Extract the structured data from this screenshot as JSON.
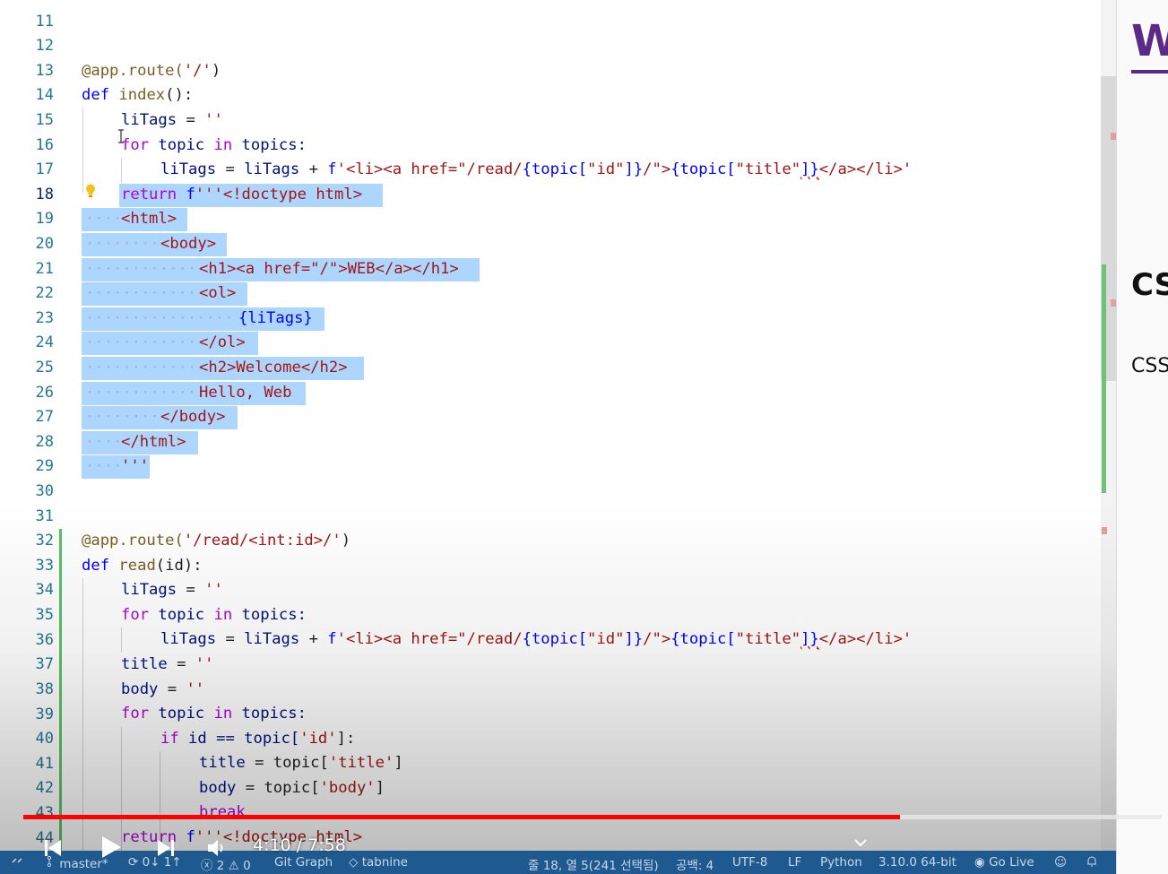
{
  "editor": {
    "lines": [
      {
        "n": "11"
      },
      {
        "n": "12"
      },
      {
        "n": "13"
      },
      {
        "n": "14"
      },
      {
        "n": "15"
      },
      {
        "n": "16"
      },
      {
        "n": "17"
      },
      {
        "n": "18"
      },
      {
        "n": "19"
      },
      {
        "n": "20"
      },
      {
        "n": "21"
      },
      {
        "n": "22"
      },
      {
        "n": "23"
      },
      {
        "n": "24"
      },
      {
        "n": "25"
      },
      {
        "n": "26"
      },
      {
        "n": "27"
      },
      {
        "n": "28"
      },
      {
        "n": "29"
      },
      {
        "n": "30"
      },
      {
        "n": "31"
      },
      {
        "n": "32"
      },
      {
        "n": "33"
      },
      {
        "n": "34"
      },
      {
        "n": "35"
      },
      {
        "n": "36"
      },
      {
        "n": "37"
      },
      {
        "n": "38"
      },
      {
        "n": "39"
      },
      {
        "n": "40"
      },
      {
        "n": "41"
      },
      {
        "n": "42"
      },
      {
        "n": "43"
      },
      {
        "n": "44"
      }
    ],
    "code": {
      "l13": [
        "@app.route(",
        "'/'",
        ")"
      ],
      "l14": [
        "def",
        " index",
        "():"
      ],
      "l15": [
        "liTags",
        " = ",
        "''"
      ],
      "l16": [
        "for",
        " topic ",
        "in",
        " topics:"
      ],
      "l17": [
        "liTags",
        " = ",
        "liTags",
        " + ",
        "f",
        "'<li><a href=\"/read/",
        "{topic[",
        "\"id\"",
        "]}",
        "/\">",
        "{topic[",
        "\"title\"",
        "]}",
        "</a></li>'"
      ],
      "l18": [
        "return",
        " f",
        "'''<!doctype html>"
      ],
      "l19": "<html>",
      "l20": "<body>",
      "l21": "<h1><a href=\"/\">WEB</a></h1>",
      "l22": "<ol>",
      "l23": "{liTags}",
      "l24": "</ol>",
      "l25": "<h2>Welcome</h2>",
      "l26": "Hello, Web",
      "l27": "</body>",
      "l28": "</html>",
      "l29": "'''",
      "l32": [
        "@app.route(",
        "'/read/<int:id>/'",
        ")"
      ],
      "l33": [
        "def",
        " read",
        "(id):"
      ],
      "l34": [
        "liTags",
        " = ",
        "''"
      ],
      "l35": [
        "for",
        " topic ",
        "in",
        " topics:"
      ],
      "l36": [
        "liTags",
        " = ",
        "liTags",
        " + ",
        "f",
        "'<li><a href=\"/read/",
        "{topic[",
        "\"id\"",
        "]}",
        "/\">",
        "{topic[",
        "\"title\"",
        "]}",
        "</a></li>'"
      ],
      "l37": [
        "title",
        " = ",
        "''"
      ],
      "l38": [
        "body",
        " = ",
        "''"
      ],
      "l39": [
        "for",
        " topic ",
        "in",
        " topics:"
      ],
      "l40": [
        "if",
        " id == topic[",
        "'id'",
        "]:"
      ],
      "l41": [
        "title",
        " = topic[",
        "'title'",
        "]"
      ],
      "l42": [
        "body",
        " = topic[",
        "'body'",
        "]"
      ],
      "l43": [
        "break"
      ],
      "l44": [
        "return",
        " f",
        "'''<!doctype html>"
      ]
    }
  },
  "side_panel": {
    "logo_text": "W",
    "heading": "CS",
    "text": "CSS"
  },
  "video": {
    "time": "4:10 / 7:58",
    "progress": 0.77
  },
  "statusbar": {
    "branch": "master*",
    "sync": "0↓ 1↑",
    "errors": "2",
    "warnings": "0",
    "git_graph": "Git Graph",
    "tabnine": "tabnine",
    "cursor": "줄 18, 열 5(241 선택됨)",
    "spaces": "공백: 4",
    "encoding": "UTF-8",
    "eol": "LF",
    "language": "Python",
    "interpreter": "3.10.0 64-bit",
    "golive": "Go Live"
  },
  "colors": {
    "selection": "#add6ff",
    "statusbar": "#1e5a8f",
    "progress": "#ff0000",
    "keyword": "#af00db",
    "string": "#a31515",
    "declaration": "#0000ff"
  }
}
